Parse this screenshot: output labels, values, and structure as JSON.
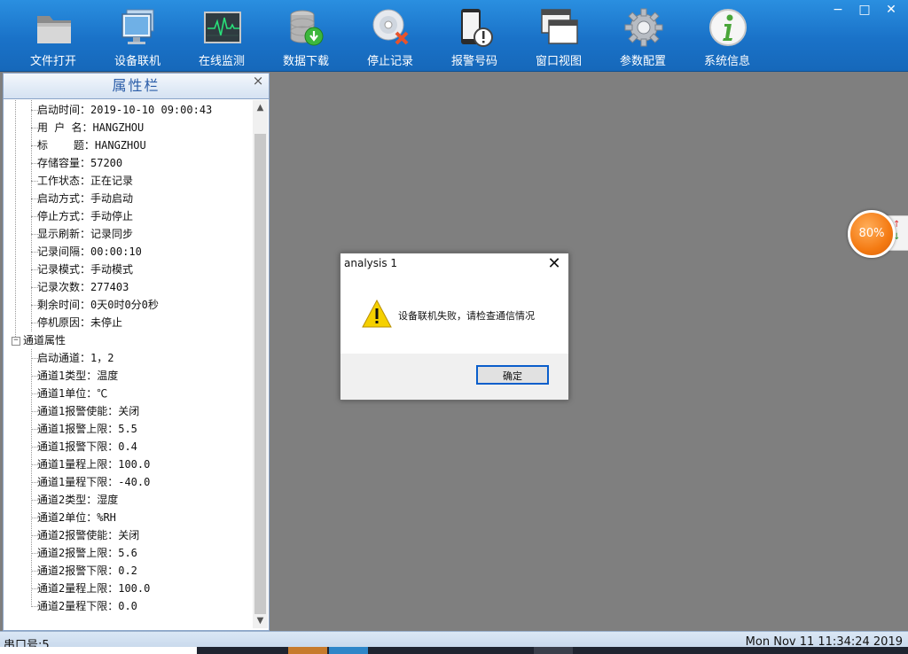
{
  "toolbar": {
    "buttons": [
      {
        "label": "文件打开",
        "icon": "folder-icon"
      },
      {
        "label": "设备联机",
        "icon": "monitor-icon"
      },
      {
        "label": "在线监测",
        "icon": "ecg-monitor-icon"
      },
      {
        "label": "数据下载",
        "icon": "database-download-icon"
      },
      {
        "label": "停止记录",
        "icon": "disc-stop-icon"
      },
      {
        "label": "报警号码",
        "icon": "phone-alert-icon"
      },
      {
        "label": "窗口视图",
        "icon": "windows-icon"
      },
      {
        "label": "参数配置",
        "icon": "gear-icon"
      },
      {
        "label": "系统信息",
        "icon": "info-icon"
      }
    ],
    "window_controls": {
      "minimize": "−",
      "maximize": "□",
      "close": "✕"
    }
  },
  "panel": {
    "title": "属性栏",
    "close": "×",
    "device_rows": [
      "启动时间：2019-10-10 09:00:43",
      "用 户 名：HANGZHOU",
      "标    题：HANGZHOU",
      "存储容量：57200",
      "工作状态：正在记录",
      "启动方式：手动启动",
      "停止方式：手动停止",
      "显示刷新：记录同步",
      "记录间隔：00:00:10",
      "记录模式：手动模式",
      "记录次数：277403",
      "剩余时间：0天0时0分0秒",
      "停机原因：未停止"
    ],
    "channel_group": "通道属性",
    "channel_rows": [
      "启动通道：1，2",
      "通道1类型：温度",
      "通道1单位：℃",
      "通道1报警使能：关闭",
      "通道1报警上限：5.5",
      "通道1报警下限：0.4",
      "通道1量程上限：100.0",
      "通道1量程下限：-40.0",
      "通道2类型：湿度",
      "通道2单位：%RH",
      "通道2报警使能：关闭",
      "通道2报警上限：5.6",
      "通道2报警下限：0.2",
      "通道2量程上限：100.0",
      "通道2量程下限：0.0"
    ]
  },
  "floating_widget": {
    "value": "80%"
  },
  "dialog": {
    "title": "analysis 1",
    "message": "设备联机失败，请检查通信情况",
    "ok_label": "确定",
    "close": "✕",
    "icon": "warning-icon"
  },
  "status": {
    "left": "串口号:5",
    "right": "Mon Nov 11 11:34:24 2019"
  },
  "colors": {
    "accent": "#1a72c8",
    "warning": "#f5d000",
    "widget": "#f47a12"
  }
}
